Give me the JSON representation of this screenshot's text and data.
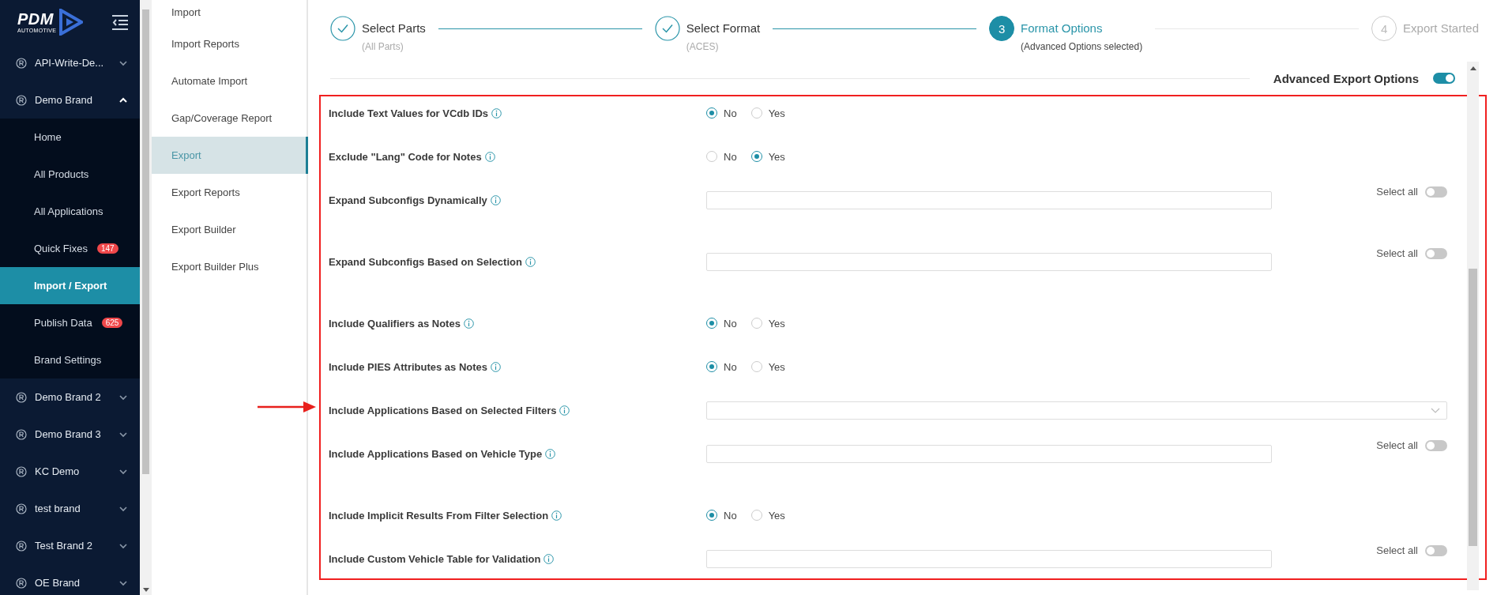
{
  "logo": {
    "name": "PDM",
    "tagline": "AUTOMOTIVE"
  },
  "sidebar": {
    "brands": [
      {
        "label": "API-Write-De...",
        "expanded": false
      },
      {
        "label": "Demo Brand",
        "expanded": true,
        "children": [
          {
            "label": "Home",
            "selected": false
          },
          {
            "label": "All Products",
            "selected": false
          },
          {
            "label": "All Applications",
            "selected": false
          },
          {
            "label": "Quick Fixes",
            "badge": "147",
            "selected": false
          },
          {
            "label": "Import / Export",
            "selected": true
          },
          {
            "label": "Publish Data",
            "badge": "625",
            "selected": false
          },
          {
            "label": "Brand Settings",
            "selected": false
          }
        ]
      },
      {
        "label": "Demo Brand 2",
        "expanded": false
      },
      {
        "label": "Demo Brand 3",
        "expanded": false
      },
      {
        "label": "KC Demo",
        "expanded": false
      },
      {
        "label": "test brand",
        "expanded": false
      },
      {
        "label": "Test Brand 2",
        "expanded": false
      },
      {
        "label": "OE Brand",
        "expanded": false
      }
    ]
  },
  "subnav": {
    "items": [
      {
        "label": "Import",
        "selected": false
      },
      {
        "label": "Import Reports",
        "selected": false
      },
      {
        "label": "Automate Import",
        "selected": false
      },
      {
        "label": "Gap/Coverage Report",
        "selected": false
      },
      {
        "label": "Export",
        "selected": true
      },
      {
        "label": "Export Reports",
        "selected": false
      },
      {
        "label": "Export Builder",
        "selected": false
      },
      {
        "label": "Export Builder Plus",
        "selected": false
      }
    ]
  },
  "steps": [
    {
      "title": "Select Parts",
      "subtitle": "(All Parts)",
      "done": true,
      "active": false
    },
    {
      "title": "Select Format",
      "subtitle": "(ACES)",
      "done": true,
      "active": false
    },
    {
      "number": "3",
      "title": "Format Options",
      "subtitle": "(Advanced Options selected)",
      "done": false,
      "active": true
    },
    {
      "number": "4",
      "title": "Export Started",
      "done": false,
      "active": false
    }
  ],
  "advanced_toggle": {
    "label": "Advanced Export Options",
    "on": true
  },
  "options": [
    {
      "kind": "radio",
      "label": "Include Text Values for VCdb IDs",
      "choices": [
        {
          "label": "No",
          "selected": true
        },
        {
          "label": "Yes",
          "selected": false
        }
      ]
    },
    {
      "kind": "radio",
      "label": "Exclude \"Lang\" Code for Notes",
      "choices": [
        {
          "label": "No",
          "selected": false
        },
        {
          "label": "Yes",
          "selected": true
        }
      ]
    },
    {
      "kind": "multiselect",
      "label": "Expand Subconfigs Dynamically",
      "select_all": {
        "label": "Select all",
        "on": false
      }
    },
    {
      "kind": "multiselect",
      "label": "Expand Subconfigs Based on Selection",
      "select_all": {
        "label": "Select all",
        "on": false
      }
    },
    {
      "kind": "radio",
      "label": "Include Qualifiers as Notes",
      "choices": [
        {
          "label": "No",
          "selected": true
        },
        {
          "label": "Yes",
          "selected": false
        }
      ]
    },
    {
      "kind": "radio",
      "label": "Include PIES Attributes as Notes",
      "choices": [
        {
          "label": "No",
          "selected": true
        },
        {
          "label": "Yes",
          "selected": false
        }
      ]
    },
    {
      "kind": "dropdown",
      "label": "Include Applications Based on Selected Filters"
    },
    {
      "kind": "multiselect",
      "label": "Include Applications Based on Vehicle Type",
      "select_all": {
        "label": "Select all",
        "on": false
      }
    },
    {
      "kind": "radio",
      "label": "Include Implicit Results From Filter Selection",
      "choices": [
        {
          "label": "No",
          "selected": true
        },
        {
          "label": "Yes",
          "selected": false
        }
      ]
    },
    {
      "kind": "multiselect",
      "label": "Include Custom Vehicle Table for Validation",
      "select_all": {
        "label": "Select all",
        "on": false
      }
    }
  ]
}
